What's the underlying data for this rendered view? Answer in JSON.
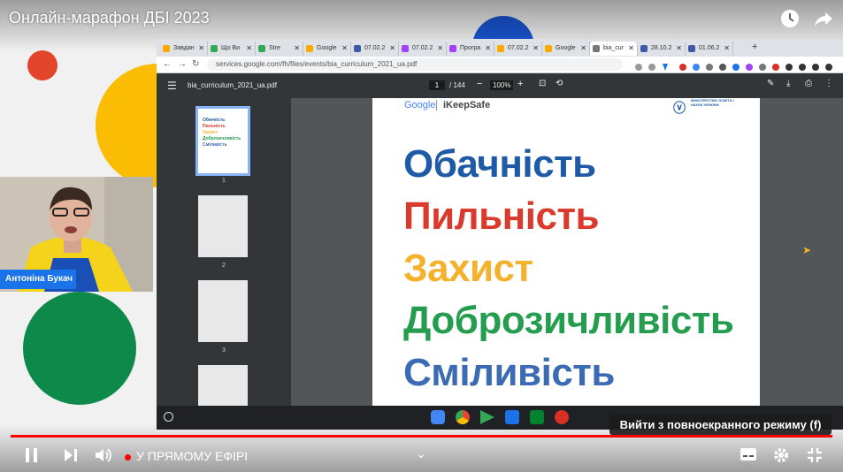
{
  "video": {
    "title": "Онлайн-марафон ДБІ 2023",
    "live_label": "У ПРЯМОМУ ЕФІРІ",
    "fullscreen_tooltip": "Вийти з повноекранного режиму (f)",
    "progress_fraction": 1.0
  },
  "speaker": {
    "name": "Антоніна Букач"
  },
  "browser": {
    "tabs": [
      {
        "label": "Завдан",
        "favicon_color": "#f9ab00"
      },
      {
        "label": "Що Ви",
        "favicon_color": "#34a853"
      },
      {
        "label": "Stre",
        "favicon_color": "#34a853"
      },
      {
        "label": "Google",
        "favicon_color": "#f9ab00"
      },
      {
        "label": "07.02.2",
        "favicon_color": "#3c5aa8"
      },
      {
        "label": "07.02.2",
        "favicon_color": "#a142f4"
      },
      {
        "label": "Програ",
        "favicon_color": "#a142f4"
      },
      {
        "label": "07.02.2",
        "favicon_color": "#f9ab00"
      },
      {
        "label": "Google",
        "favicon_color": "#f9ab00"
      },
      {
        "label": "bia_cur",
        "favicon_color": "#777777"
      },
      {
        "label": "28.10.2",
        "favicon_color": "#3c5aa8"
      },
      {
        "label": "01.06.2",
        "favicon_color": "#3c5aa8"
      }
    ],
    "active_tab_index": 9,
    "url": "services.google.com/fh/files/events/bia_curriculum_2021_ua.pdf"
  },
  "pdf": {
    "filename": "bia_curriculum_2021_ua.pdf",
    "current_page": "1",
    "total_pages": "/ 144",
    "zoom": "100%",
    "thumbnail_numbers": [
      "1",
      "2",
      "3"
    ],
    "page_header": {
      "google": "Google",
      "ikeepsafe": "iKeepSafe",
      "ministry": "МІНІСТЕРСТВО ОСВІТИ І НАУКИ УКРАЇНИ"
    },
    "words": [
      {
        "text": "Обачність",
        "color": "#1e5aa5"
      },
      {
        "text": "Пильність",
        "color": "#d93a2b"
      },
      {
        "text": "Захист",
        "color": "#f3b12c"
      },
      {
        "text": "Доброзичливість",
        "color": "#259d4e"
      },
      {
        "text": "Сміливість",
        "color": "#3b6bb3"
      }
    ]
  },
  "colors": {
    "player_red": "#ff0000",
    "deco_red": "#e2452a",
    "deco_yellow": "#fbbc04",
    "deco_green": "#0d8a4a",
    "deco_blue": "#1a56d6",
    "name_tag_blue": "#1a73e8"
  }
}
